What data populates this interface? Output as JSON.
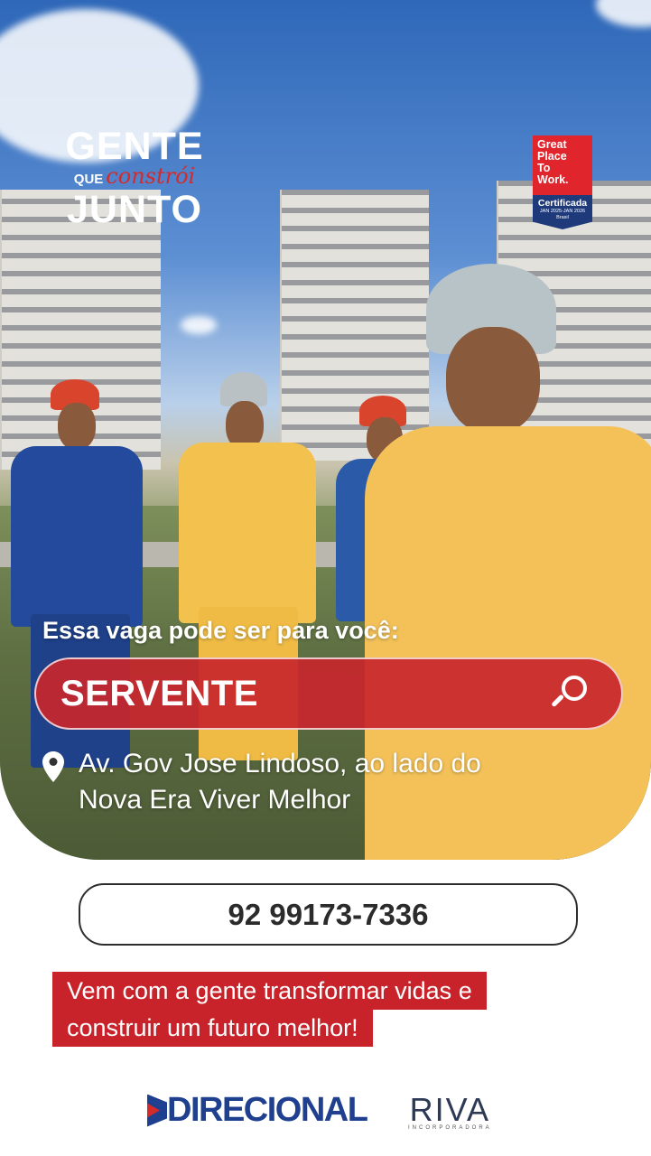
{
  "campaign_logo": {
    "line1": "GENTE",
    "que": "QUE",
    "constroi": "constrói",
    "line3": "JUNTO"
  },
  "certification_badge": {
    "line1": "Great",
    "line2": "Place",
    "line3": "To",
    "line4": "Work.",
    "certified": "Certificada",
    "period": "JAN 2025-JAN 2026",
    "country": "Brasil"
  },
  "vacancy": {
    "intro": "Essa vaga pode ser para você:",
    "job_title": "SERVENTE",
    "location_line1": "Av. Gov Jose Lindoso, ao lado do",
    "location_line2": "Nova Era Viver Melhor"
  },
  "contact": {
    "phone": "92 99173-7336"
  },
  "slogan": {
    "line1": "Vem com a gente transformar vidas e",
    "line2": "construir um futuro melhor!"
  },
  "brands": {
    "direcional": "DIRECIONAL",
    "riva": "RIVA",
    "riva_sub": "INCORPORADORA"
  },
  "colors": {
    "brand_red": "#c8232b",
    "brand_blue": "#1f3f8f"
  }
}
